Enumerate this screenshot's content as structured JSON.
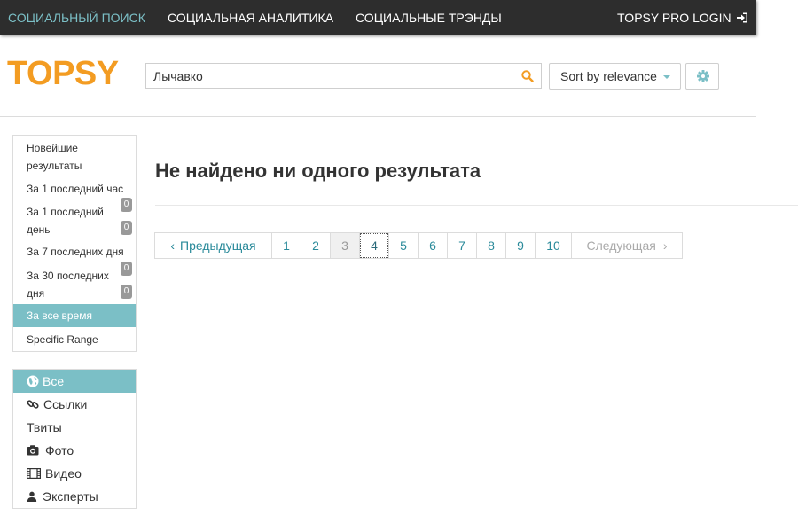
{
  "topnav": {
    "items": [
      {
        "label": "СОЦИАЛЬНЫЙ ПОИСК",
        "active": true
      },
      {
        "label": "СОЦИАЛЬНАЯ АНАЛИТИКА",
        "active": false
      },
      {
        "label": "СОЦИАЛЬНЫЕ ТРЭНДЫ",
        "active": false
      }
    ],
    "login": "TOPSY PRO LOGIN"
  },
  "logo": "TOPSY",
  "search": {
    "value": "Лычавко",
    "icon": "search-icon"
  },
  "sort": {
    "label": "Sort by relevance"
  },
  "settings": {
    "icon": "gear-icon"
  },
  "time_filters": [
    {
      "label_line1": "Новейшие",
      "label_line2": "результаты"
    },
    {
      "label": "За 1 последний час"
    },
    {
      "label_line1": "За 1 последний",
      "label_line2": "день",
      "badge1": "0",
      "badge2": "0"
    },
    {
      "label": "За 7 последних дня"
    },
    {
      "label_line1": "За 30 последних",
      "label_line2": "дня",
      "badge1": "0",
      "badge2": "0"
    },
    {
      "label": "За все время",
      "active": true
    },
    {
      "label": "Specific Range"
    }
  ],
  "type_filters": [
    {
      "label": "Все",
      "icon": "globe-icon",
      "active": true
    },
    {
      "label": "Ссылки",
      "icon": "link-icon"
    },
    {
      "label": "Твиты"
    },
    {
      "label": "Фото",
      "icon": "camera-icon"
    },
    {
      "label": "Видео",
      "icon": "film-icon"
    },
    {
      "label": "Эксперты",
      "icon": "user-icon"
    }
  ],
  "main": {
    "title": "Не найдено ни одного результата"
  },
  "pagination": {
    "prev": "Предыдущая",
    "pages": [
      "1",
      "2",
      "3",
      "4",
      "5",
      "6",
      "7",
      "8",
      "9",
      "10"
    ],
    "current": "3",
    "next": "Следующая"
  },
  "colors": {
    "accent": "#7bbfc6",
    "brand": "#f39c22",
    "topbar": "#2d2d2d"
  }
}
